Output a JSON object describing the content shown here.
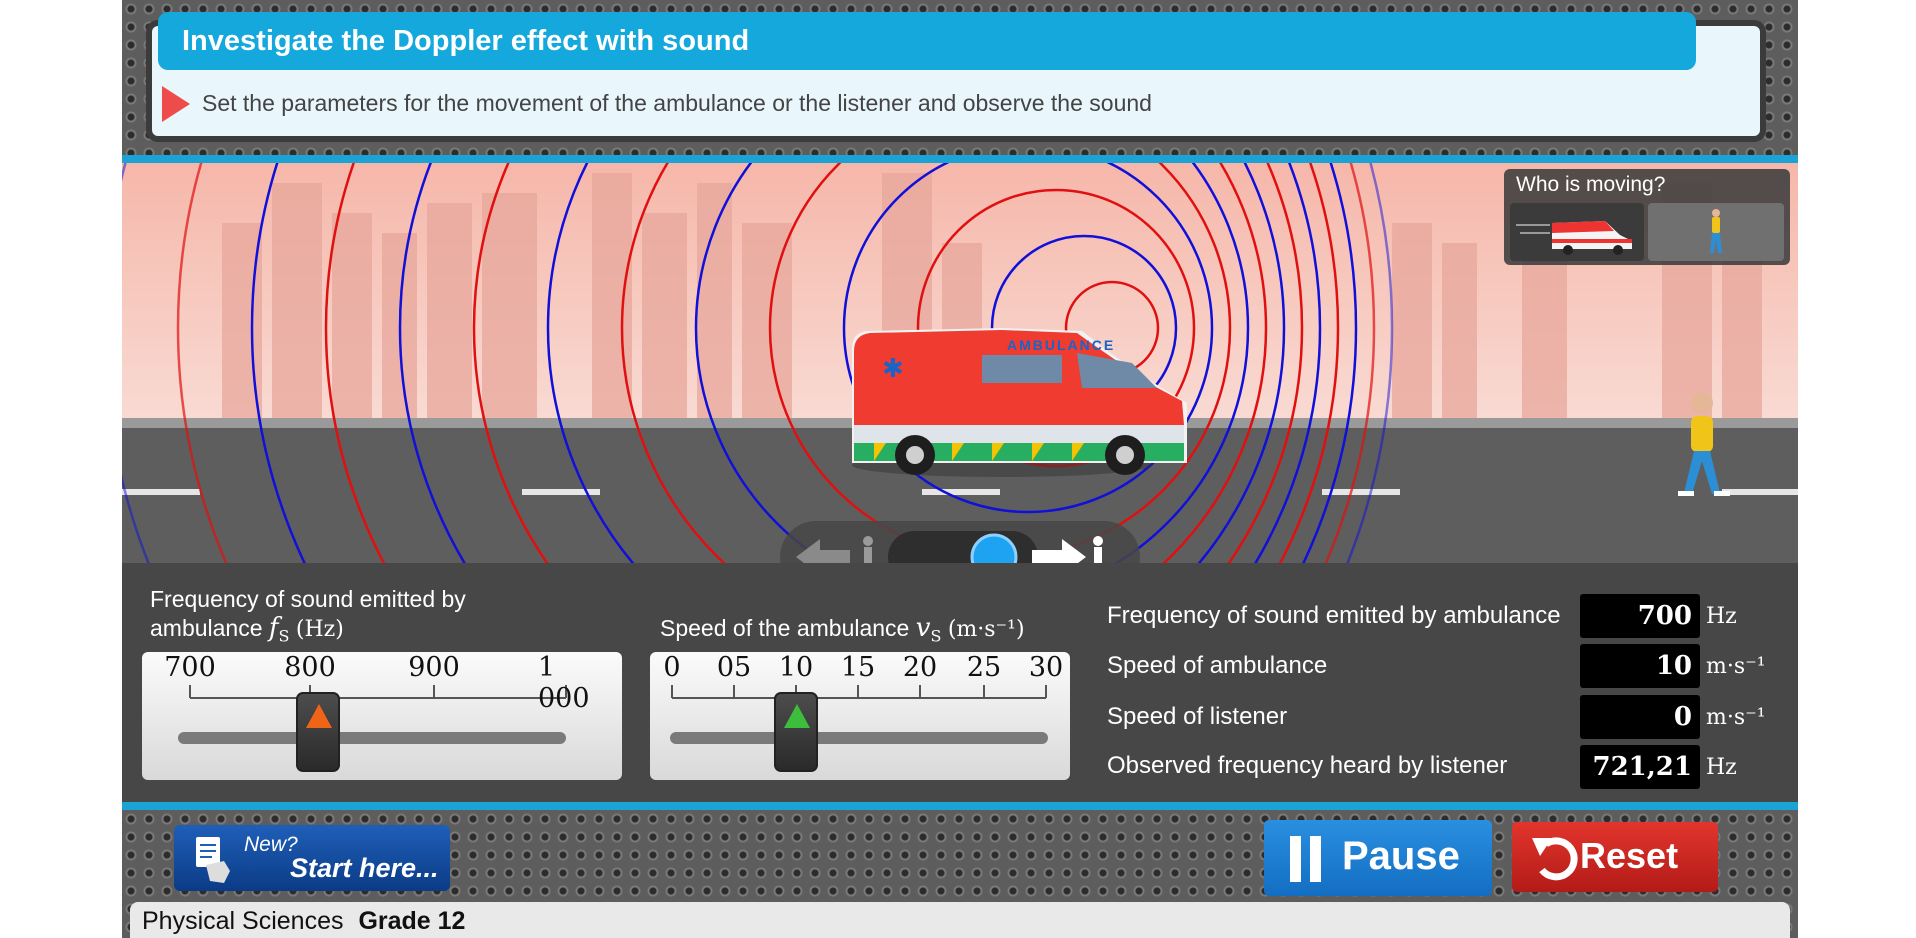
{
  "header": {
    "title": "Investigate the Doppler effect with sound",
    "instruction": "Set the parameters for the movement of the ambulance or the listener and observe the sound"
  },
  "scene": {
    "who_is_moving_label": "Who is moving?",
    "ambulance_text": "AMBULANCE",
    "moving_option_selected": "ambulance"
  },
  "controls": {
    "frequency_slider": {
      "label_line1": "Frequency of sound emitted by",
      "label_line2": "ambulance",
      "symbol": "f",
      "subscript": "S",
      "unit": "(Hz)",
      "ticks": [
        "700",
        "800",
        "900",
        "1 000"
      ],
      "value": 700,
      "thumb_color": "#f06418"
    },
    "speed_slider": {
      "label": "Speed of the ambulance",
      "symbol": "v",
      "subscript": "S",
      "unit": "(m·s⁻¹)",
      "ticks": [
        "0",
        "05",
        "10",
        "15",
        "20",
        "25",
        "30"
      ],
      "value": 10,
      "thumb_color": "#3cbe3c"
    },
    "readouts": [
      {
        "label": "Frequency of sound emitted by ambulance",
        "value": "700",
        "unit": "Hz"
      },
      {
        "label": "Speed of ambulance",
        "value": "10",
        "unit": "m·s⁻¹"
      },
      {
        "label": "Speed of listener",
        "value": "0",
        "unit": "m·s⁻¹"
      },
      {
        "label": "Observed frequency heard by listener",
        "value": "721,21",
        "unit": "Hz"
      }
    ]
  },
  "footer": {
    "start_new": "New?",
    "start_label": "Start here...",
    "pause_label": "Pause",
    "reset_label": "Reset",
    "subject": "Physical Sciences",
    "grade": "Grade 12"
  },
  "colors": {
    "accent_blue": "#14a8dc",
    "pause_blue": "#1d7fd4",
    "reset_red": "#c8241d",
    "wave_red": "#e01010",
    "wave_blue": "#1010d8"
  }
}
